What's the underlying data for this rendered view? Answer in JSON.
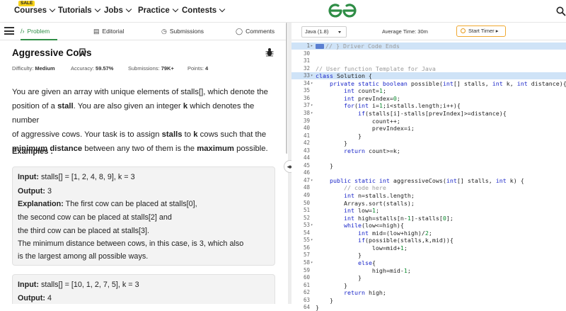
{
  "nav": {
    "sale_badge": "SALE",
    "items": [
      "Courses",
      "Tutorials",
      "Jobs",
      "Practice",
      "Contests"
    ],
    "logo_text": "GfG"
  },
  "tabs": [
    {
      "label": "Problem",
      "icon": "code-icon",
      "active": true
    },
    {
      "label": "Editorial",
      "icon": "document-icon",
      "active": false
    },
    {
      "label": "Submissions",
      "icon": "clock-icon",
      "active": false
    },
    {
      "label": "Comments",
      "icon": "comment-icon",
      "active": false
    }
  ],
  "problem": {
    "title": "Aggressive Cows",
    "difficulty_label": "Difficulty:",
    "difficulty": "Medium",
    "accuracy_label": "Accuracy:",
    "accuracy": "59.57%",
    "submissions_label": "Submissions:",
    "submissions": "79K+",
    "points_label": "Points:",
    "points": "4",
    "desc": {
      "l1": "You are given an array with unique elements of stalls[], which denote the",
      "l2a": "position of a ",
      "l2b": "stall",
      "l2c": ". You are also given an integer ",
      "l2d": "k",
      "l2e": " which denotes the number",
      "l3a": "of aggressive cows. Your task is to assign ",
      "l3b": "stalls",
      "l3c": " to ",
      "l3d": "k",
      "l3e": " cows such that the",
      "l4a": "minimum distance",
      "l4b": " between any two of them is the ",
      "l4c": "maximum",
      "l4d": " possible."
    },
    "examples_heading": "Examples :",
    "example1": {
      "input_label": "Input:",
      "input": " stalls[] = [1, 2, 4, 8, 9], k = 3",
      "output_label": "Output:",
      "output": " 3",
      "explanation_label": "Explanation:",
      "explanation_lines": [
        " The first cow can be placed at stalls[0],",
        "the second cow can be placed at stalls[2] and",
        "the third cow can be placed at stalls[3].",
        "The minimum distance between cows, in this case, is 3, which also",
        "is the largest among all possible ways."
      ]
    },
    "example2": {
      "input_label": "Input:",
      "input": " stalls[] = [10, 1, 2, 7, 5], k = 3",
      "output_label": "Output:",
      "output": " 4"
    }
  },
  "toolbar": {
    "language": "Java (1.8)",
    "avg_time": "Average Time: 30m",
    "timer_label": "Start Timer"
  },
  "code_lines": [
    {
      "n": "1",
      "fold": "▸",
      "html": "<span class=\"fold-box\"></span><span class=\"cm\">// } Driver Code Ends</span>",
      "hl": true
    },
    {
      "n": "30",
      "fold": "",
      "html": ""
    },
    {
      "n": "31",
      "fold": "",
      "html": ""
    },
    {
      "n": "32",
      "fold": "",
      "html": "<span class=\"cm\">// User function Template for Java</span>"
    },
    {
      "n": "33",
      "fold": "▾",
      "html": "<span class=\"kw\">class</span> Solution {",
      "hl": true
    },
    {
      "n": "34",
      "fold": "▾",
      "html": "    <span class=\"kw\">private static boolean</span> possible(<span class=\"kw\">int</span>[] stalls, <span class=\"kw\">int</span> k, <span class=\"kw\">int</span> distance){"
    },
    {
      "n": "35",
      "fold": "",
      "html": "        <span class=\"kw\">int</span> count=<span class=\"num\">1</span>;"
    },
    {
      "n": "36",
      "fold": "",
      "html": "        <span class=\"kw\">int</span> prevIndex=<span class=\"num\">0</span>;"
    },
    {
      "n": "37",
      "fold": "▾",
      "html": "        <span class=\"kw\">for</span>(<span class=\"kw\">int</span> i=<span class=\"num\">1</span>;i&lt;stalls.length;i++){"
    },
    {
      "n": "38",
      "fold": "▾",
      "html": "            <span class=\"kw\">if</span>(stalls[i]-stalls[prevIndex]&gt;=distance){"
    },
    {
      "n": "39",
      "fold": "",
      "html": "                count++;"
    },
    {
      "n": "40",
      "fold": "",
      "html": "                prevIndex=i;"
    },
    {
      "n": "41",
      "fold": "",
      "html": "            }"
    },
    {
      "n": "42",
      "fold": "",
      "html": "        }"
    },
    {
      "n": "43",
      "fold": "",
      "html": "        <span class=\"kw\">return</span> count&gt;=k;"
    },
    {
      "n": "44",
      "fold": "",
      "html": ""
    },
    {
      "n": "45",
      "fold": "",
      "html": "    }"
    },
    {
      "n": "46",
      "fold": "",
      "html": ""
    },
    {
      "n": "47",
      "fold": "▾",
      "html": "    <span class=\"kw\">public static int</span> aggressiveCows(<span class=\"kw\">int</span>[] stalls, <span class=\"kw\">int</span> k) {"
    },
    {
      "n": "48",
      "fold": "",
      "html": "        <span class=\"cm\">// code here</span>"
    },
    {
      "n": "49",
      "fold": "",
      "html": "        <span class=\"kw\">int</span> n=stalls.length;"
    },
    {
      "n": "50",
      "fold": "",
      "html": "        Arrays.sort(stalls);"
    },
    {
      "n": "51",
      "fold": "",
      "html": "        <span class=\"kw\">int</span> low=<span class=\"num\">1</span>;"
    },
    {
      "n": "52",
      "fold": "",
      "html": "        <span class=\"kw\">int</span> high=stalls[n-<span class=\"num\">1</span>]-stalls[<span class=\"num\">0</span>];"
    },
    {
      "n": "53",
      "fold": "▾",
      "html": "        <span class=\"kw\">while</span>(low&lt;=high){"
    },
    {
      "n": "54",
      "fold": "",
      "html": "            <span class=\"kw\">int</span> mid=(low+high)/<span class=\"num\">2</span>;"
    },
    {
      "n": "55",
      "fold": "▾",
      "html": "            <span class=\"kw\">if</span>(possible(stalls,k,mid)){"
    },
    {
      "n": "56",
      "fold": "",
      "html": "                low=mid+<span class=\"num\">1</span>;"
    },
    {
      "n": "57",
      "fold": "",
      "html": "            }"
    },
    {
      "n": "58",
      "fold": "▾",
      "html": "            <span class=\"kw\">else</span>{"
    },
    {
      "n": "59",
      "fold": "",
      "html": "                high=mid-<span class=\"num\">1</span>;"
    },
    {
      "n": "60",
      "fold": "",
      "html": "            }"
    },
    {
      "n": "61",
      "fold": "",
      "html": "        }"
    },
    {
      "n": "62",
      "fold": "",
      "html": "        <span class=\"kw\">return</span> high;"
    },
    {
      "n": "63",
      "fold": "",
      "html": "    }"
    },
    {
      "n": "64",
      "fold": "",
      "html": "}"
    }
  ]
}
